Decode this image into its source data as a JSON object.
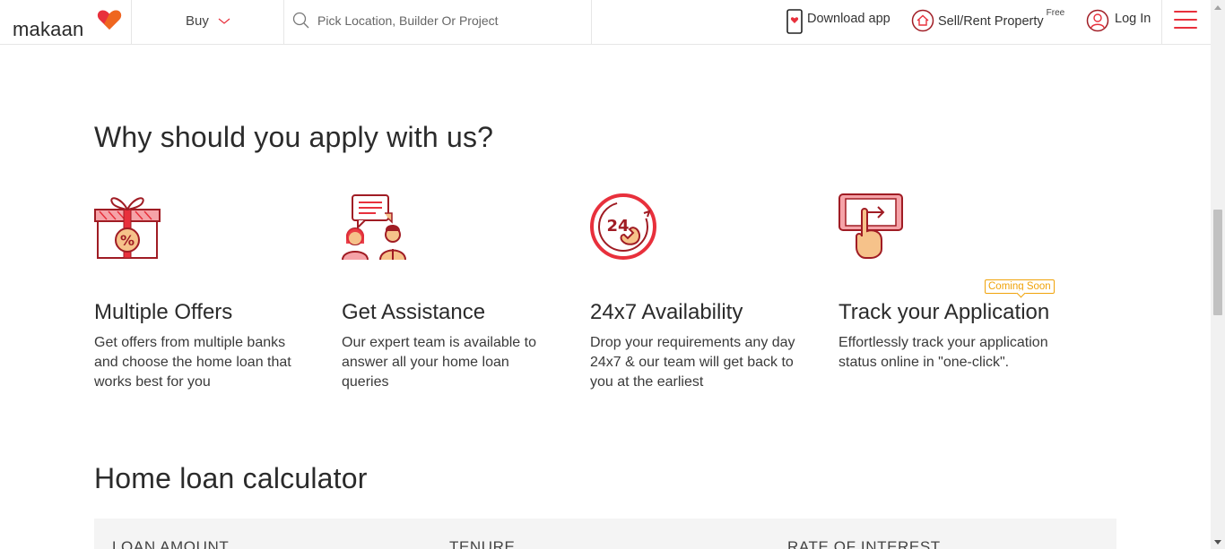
{
  "header": {
    "logo_text": "makaan",
    "buy_label": "Buy",
    "search_placeholder": "Pick Location, Builder Or Project",
    "download_label": "Download app",
    "sell_label": "Sell/Rent Property",
    "sell_badge": "Free",
    "login_label": "Log In"
  },
  "why": {
    "title": "Why should you apply with us?",
    "features": [
      {
        "icon": "gift-percent-icon",
        "title": "Multiple Offers",
        "desc": "Get offers from multiple banks and choose the home loan that works best for you"
      },
      {
        "icon": "support-agents-icon",
        "title": "Get Assistance",
        "desc": "Our expert team is available to answer all your home loan queries"
      },
      {
        "icon": "24x7-phone-icon",
        "title": "24x7 Availability",
        "desc": "Drop your requirements any day 24x7 & our team will get back to you at the earliest"
      },
      {
        "icon": "tap-track-icon",
        "title": "Track your Application",
        "desc": "Effortlessly track your application status online in \"one-click\".",
        "badge": "Coming Soon"
      }
    ]
  },
  "calculator": {
    "title": "Home loan calculator",
    "fields": [
      "LOAN AMOUNT",
      "TENURE",
      "RATE OF INTEREST"
    ]
  },
  "colors": {
    "brand_red": "#e8303c",
    "icon_dark_red": "#a01c24",
    "badge_orange": "#f0a30a"
  }
}
